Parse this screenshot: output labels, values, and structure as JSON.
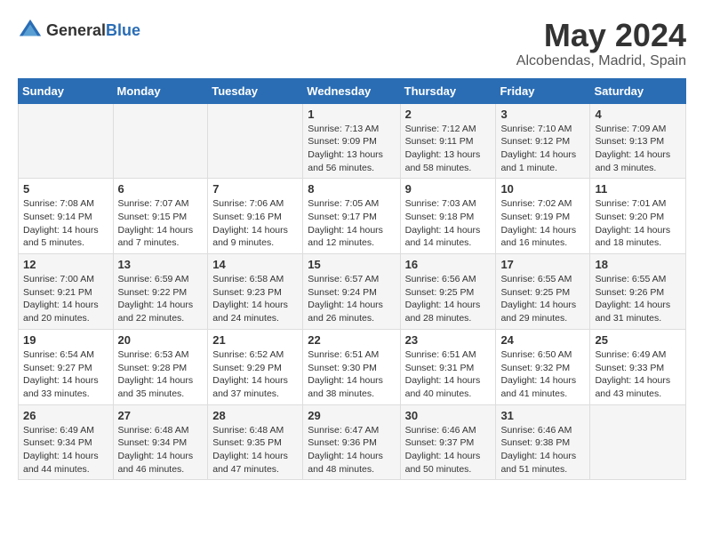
{
  "header": {
    "logo_general": "General",
    "logo_blue": "Blue",
    "month": "May 2024",
    "location": "Alcobendas, Madrid, Spain"
  },
  "weekdays": [
    "Sunday",
    "Monday",
    "Tuesday",
    "Wednesday",
    "Thursday",
    "Friday",
    "Saturday"
  ],
  "weeks": [
    [
      {
        "day": "",
        "info": ""
      },
      {
        "day": "",
        "info": ""
      },
      {
        "day": "",
        "info": ""
      },
      {
        "day": "1",
        "info": "Sunrise: 7:13 AM\nSunset: 9:09 PM\nDaylight: 13 hours and 56 minutes."
      },
      {
        "day": "2",
        "info": "Sunrise: 7:12 AM\nSunset: 9:11 PM\nDaylight: 13 hours and 58 minutes."
      },
      {
        "day": "3",
        "info": "Sunrise: 7:10 AM\nSunset: 9:12 PM\nDaylight: 14 hours and 1 minute."
      },
      {
        "day": "4",
        "info": "Sunrise: 7:09 AM\nSunset: 9:13 PM\nDaylight: 14 hours and 3 minutes."
      }
    ],
    [
      {
        "day": "5",
        "info": "Sunrise: 7:08 AM\nSunset: 9:14 PM\nDaylight: 14 hours and 5 minutes."
      },
      {
        "day": "6",
        "info": "Sunrise: 7:07 AM\nSunset: 9:15 PM\nDaylight: 14 hours and 7 minutes."
      },
      {
        "day": "7",
        "info": "Sunrise: 7:06 AM\nSunset: 9:16 PM\nDaylight: 14 hours and 9 minutes."
      },
      {
        "day": "8",
        "info": "Sunrise: 7:05 AM\nSunset: 9:17 PM\nDaylight: 14 hours and 12 minutes."
      },
      {
        "day": "9",
        "info": "Sunrise: 7:03 AM\nSunset: 9:18 PM\nDaylight: 14 hours and 14 minutes."
      },
      {
        "day": "10",
        "info": "Sunrise: 7:02 AM\nSunset: 9:19 PM\nDaylight: 14 hours and 16 minutes."
      },
      {
        "day": "11",
        "info": "Sunrise: 7:01 AM\nSunset: 9:20 PM\nDaylight: 14 hours and 18 minutes."
      }
    ],
    [
      {
        "day": "12",
        "info": "Sunrise: 7:00 AM\nSunset: 9:21 PM\nDaylight: 14 hours and 20 minutes."
      },
      {
        "day": "13",
        "info": "Sunrise: 6:59 AM\nSunset: 9:22 PM\nDaylight: 14 hours and 22 minutes."
      },
      {
        "day": "14",
        "info": "Sunrise: 6:58 AM\nSunset: 9:23 PM\nDaylight: 14 hours and 24 minutes."
      },
      {
        "day": "15",
        "info": "Sunrise: 6:57 AM\nSunset: 9:24 PM\nDaylight: 14 hours and 26 minutes."
      },
      {
        "day": "16",
        "info": "Sunrise: 6:56 AM\nSunset: 9:25 PM\nDaylight: 14 hours and 28 minutes."
      },
      {
        "day": "17",
        "info": "Sunrise: 6:55 AM\nSunset: 9:25 PM\nDaylight: 14 hours and 29 minutes."
      },
      {
        "day": "18",
        "info": "Sunrise: 6:55 AM\nSunset: 9:26 PM\nDaylight: 14 hours and 31 minutes."
      }
    ],
    [
      {
        "day": "19",
        "info": "Sunrise: 6:54 AM\nSunset: 9:27 PM\nDaylight: 14 hours and 33 minutes."
      },
      {
        "day": "20",
        "info": "Sunrise: 6:53 AM\nSunset: 9:28 PM\nDaylight: 14 hours and 35 minutes."
      },
      {
        "day": "21",
        "info": "Sunrise: 6:52 AM\nSunset: 9:29 PM\nDaylight: 14 hours and 37 minutes."
      },
      {
        "day": "22",
        "info": "Sunrise: 6:51 AM\nSunset: 9:30 PM\nDaylight: 14 hours and 38 minutes."
      },
      {
        "day": "23",
        "info": "Sunrise: 6:51 AM\nSunset: 9:31 PM\nDaylight: 14 hours and 40 minutes."
      },
      {
        "day": "24",
        "info": "Sunrise: 6:50 AM\nSunset: 9:32 PM\nDaylight: 14 hours and 41 minutes."
      },
      {
        "day": "25",
        "info": "Sunrise: 6:49 AM\nSunset: 9:33 PM\nDaylight: 14 hours and 43 minutes."
      }
    ],
    [
      {
        "day": "26",
        "info": "Sunrise: 6:49 AM\nSunset: 9:34 PM\nDaylight: 14 hours and 44 minutes."
      },
      {
        "day": "27",
        "info": "Sunrise: 6:48 AM\nSunset: 9:34 PM\nDaylight: 14 hours and 46 minutes."
      },
      {
        "day": "28",
        "info": "Sunrise: 6:48 AM\nSunset: 9:35 PM\nDaylight: 14 hours and 47 minutes."
      },
      {
        "day": "29",
        "info": "Sunrise: 6:47 AM\nSunset: 9:36 PM\nDaylight: 14 hours and 48 minutes."
      },
      {
        "day": "30",
        "info": "Sunrise: 6:46 AM\nSunset: 9:37 PM\nDaylight: 14 hours and 50 minutes."
      },
      {
        "day": "31",
        "info": "Sunrise: 6:46 AM\nSunset: 9:38 PM\nDaylight: 14 hours and 51 minutes."
      },
      {
        "day": "",
        "info": ""
      }
    ]
  ]
}
